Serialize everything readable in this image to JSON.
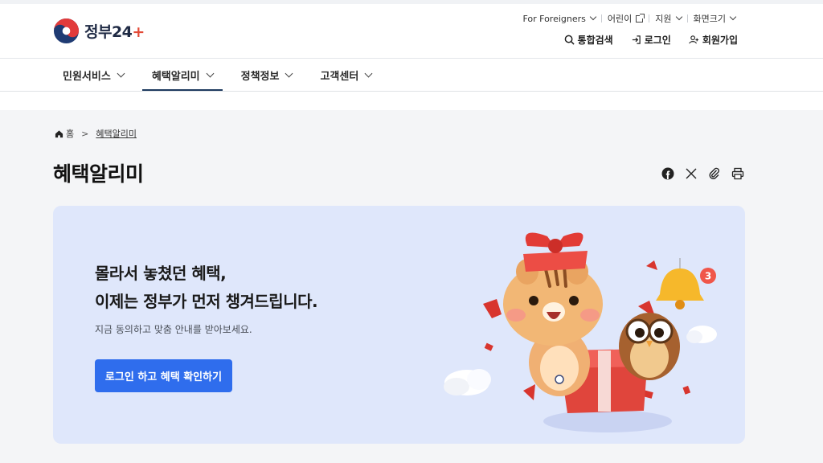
{
  "brand": {
    "logo_text": "정부24",
    "logo_plus": "+"
  },
  "utility": {
    "for_foreigners": "For Foreigners",
    "kids": "어린이",
    "support": "지원",
    "screen_size": "화면크기"
  },
  "actions": {
    "search": "통합검색",
    "login": "로그인",
    "signup": "회원가입"
  },
  "nav": {
    "items": [
      {
        "label": "민원서비스"
      },
      {
        "label": "혜택알리미"
      },
      {
        "label": "정책정보"
      },
      {
        "label": "고객센터"
      }
    ],
    "active_index": 1
  },
  "breadcrumb": {
    "home": "홈",
    "current": "혜택알리미"
  },
  "page": {
    "title": "혜택알리미"
  },
  "share": {
    "icons": [
      "facebook-icon",
      "x-icon",
      "link-icon",
      "print-icon"
    ]
  },
  "banner": {
    "headline_line1": "몰라서 놓쳤던 혜택,",
    "headline_line2": "이제는 정부가 먼저 챙겨드립니다.",
    "subtext": "지금 동의하고 맞춤 안내를 받아보세요.",
    "cta_label": "로그인 하고 혜택 확인하기",
    "bell_badge": "3"
  },
  "colors": {
    "primary_button": "#2f6ded",
    "banner_bg": "#dfe7fb",
    "nav_active": "#1e3a5f",
    "logo_red": "#e34a36",
    "logo_navy": "#1f2a44"
  }
}
